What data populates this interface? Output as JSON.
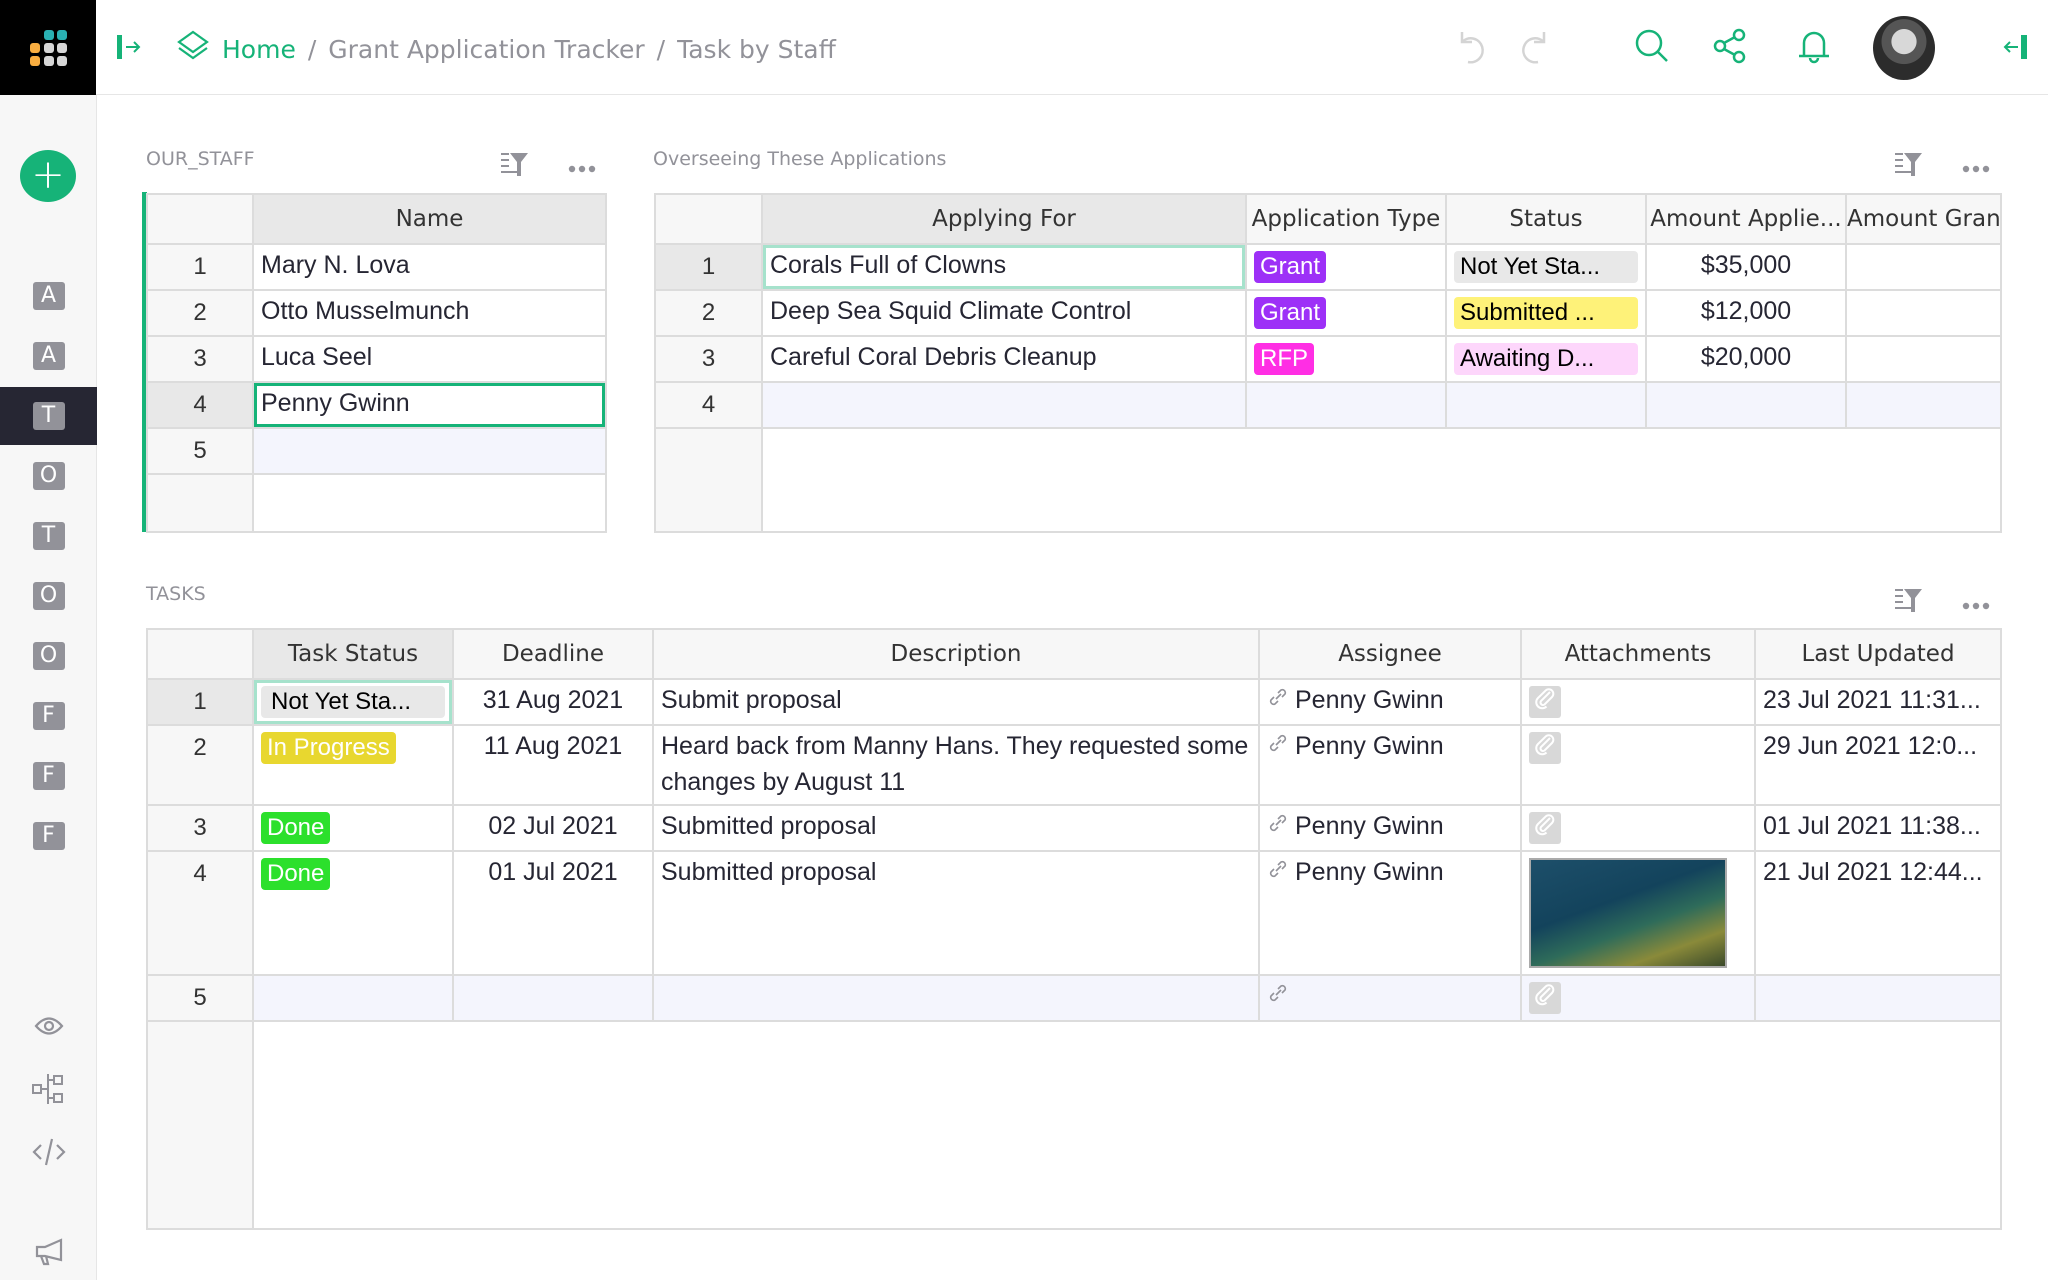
{
  "topbar": {
    "breadcrumb": {
      "home": "Home",
      "doc": "Grant Application Tracker",
      "page": "Task by Staff"
    },
    "icons": [
      "panel-open-icon",
      "layers-icon",
      "undo-icon",
      "redo-icon",
      "search-icon",
      "share-icon",
      "bell-icon",
      "avatar",
      "panel-close-icon"
    ]
  },
  "sidebar": {
    "add_label": "+",
    "pages": [
      {
        "letter": "A",
        "active": false
      },
      {
        "letter": "A",
        "active": false
      },
      {
        "letter": "T",
        "active": true
      },
      {
        "letter": "O",
        "active": false
      },
      {
        "letter": "T",
        "active": false
      },
      {
        "letter": "O",
        "active": false
      },
      {
        "letter": "O",
        "active": false
      },
      {
        "letter": "F",
        "active": false
      },
      {
        "letter": "F",
        "active": false
      },
      {
        "letter": "F",
        "active": false
      }
    ],
    "tools": [
      "eye-icon",
      "structure-icon",
      "code-icon",
      "megaphone-icon"
    ]
  },
  "staff": {
    "title": "OUR_STAFF",
    "columns": [
      "Name"
    ],
    "rows": [
      {
        "n": "1",
        "name": "Mary N. Lova"
      },
      {
        "n": "2",
        "name": "Otto Musselmunch"
      },
      {
        "n": "3",
        "name": "Luca Seel"
      },
      {
        "n": "4",
        "name": "Penny Gwinn"
      },
      {
        "n": "5",
        "name": ""
      }
    ]
  },
  "applications": {
    "title": "Overseeing These Applications",
    "columns": [
      "Applying For",
      "Application Type",
      "Status",
      "Amount Applie...",
      "Amount Gran"
    ],
    "rows": [
      {
        "n": "1",
        "applying_for": "Corals Full of Clowns",
        "type": "Grant",
        "status": "Not Yet Sta...",
        "amount": "$35,000",
        "granted": ""
      },
      {
        "n": "2",
        "applying_for": "Deep Sea Squid Climate Control",
        "type": "Grant",
        "status": "Submitted ...",
        "amount": "$12,000",
        "granted": ""
      },
      {
        "n": "3",
        "applying_for": "Careful Coral Debris Cleanup",
        "type": "RFP",
        "status": "Awaiting D...",
        "amount": "$20,000",
        "granted": ""
      },
      {
        "n": "4",
        "applying_for": "",
        "type": "",
        "status": "",
        "amount": "",
        "granted": ""
      }
    ],
    "colors": {
      "Grant": "#9d30f7",
      "RFP": "#ff2ee4",
      "Not Yet Sta...": "#e8e8e8",
      "Submitted ...": "#fef279",
      "Awaiting D...": "#fdd6fb"
    }
  },
  "tasks": {
    "title": "TASKS",
    "columns": [
      "Task Status",
      "Deadline",
      "Description",
      "Assignee",
      "Attachments",
      "Last Updated"
    ],
    "rows": [
      {
        "n": "1",
        "status": "Not Yet Sta...",
        "deadline": "31 Aug 2021",
        "description": "Submit proposal",
        "assignee": "Penny Gwinn",
        "attachment": "paperclip",
        "updated": "23 Jul 2021 11:31..."
      },
      {
        "n": "2",
        "status": "In Progress",
        "deadline": "11 Aug 2021",
        "description": "Heard back from Manny Hans. They requested some changes by August 11",
        "assignee": "Penny Gwinn",
        "attachment": "paperclip",
        "updated": "29 Jun 2021 12:0..."
      },
      {
        "n": "3",
        "status": "Done",
        "deadline": "02 Jul 2021",
        "description": "Submitted proposal",
        "assignee": "Penny Gwinn",
        "attachment": "paperclip",
        "updated": "01 Jul 2021 11:38..."
      },
      {
        "n": "4",
        "status": "Done",
        "deadline": "01 Jul 2021",
        "description": "Submitted proposal",
        "assignee": "Penny Gwinn",
        "attachment": "diver-photo-thumbnail",
        "updated": "21 Jul 2021 12:44..."
      },
      {
        "n": "5",
        "status": "",
        "deadline": "",
        "description": "",
        "assignee": "",
        "attachment": "paperclip",
        "updated": ""
      }
    ],
    "colors": {
      "Not Yet Sta...": "#e8e8e8",
      "In Progress": "#e8d72f",
      "Done": "#2ce02c"
    }
  },
  "colors": {
    "accent": "#16b378",
    "muted": "#929299",
    "text": "#262633"
  }
}
